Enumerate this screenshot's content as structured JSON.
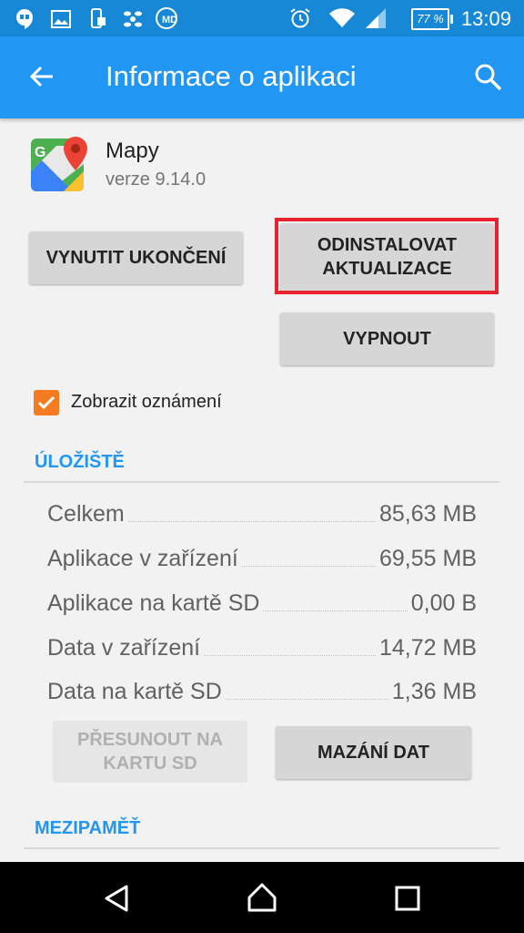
{
  "status_bar": {
    "battery": "77 %",
    "time": "13:09",
    "icons": [
      "hangouts-icon",
      "image-icon",
      "phone-sync-icon",
      "flower-icon",
      "md-app-icon",
      "alarm-icon",
      "wifi-icon",
      "signal-icon",
      "battery-icon"
    ]
  },
  "app_bar": {
    "title": "Informace o aplikaci",
    "color": "#2196f3"
  },
  "app": {
    "name": "Mapy",
    "version": "verze 9.14.0",
    "icon": "google-maps-icon"
  },
  "buttons": {
    "force_stop": "VYNUTIT UKONČENÍ",
    "uninstall_updates_line1": "ODINSTALOVAT",
    "uninstall_updates_line2": "AKTUALIZACE",
    "disable": "VYPNOUT"
  },
  "notifications": {
    "label": "Zobrazit oznámení",
    "checked": true
  },
  "storage": {
    "header": "ÚLOŽIŠTĚ",
    "rows": [
      {
        "label": "Celkem",
        "value": "85,63 MB"
      },
      {
        "label": "Aplikace v zařízení",
        "value": "69,55 MB"
      },
      {
        "label": "Aplikace na kartě SD",
        "value": "0,00 B"
      },
      {
        "label": "Data v zařízení",
        "value": "14,72 MB"
      },
      {
        "label": "Data na kartě SD",
        "value": "1,36 MB"
      }
    ],
    "move_line1": "PŘESUNOUT NA",
    "move_line2": "KARTU SD",
    "clear_data": "MAZÁNÍ DAT"
  },
  "cache": {
    "header": "MEZIPAMĚŤ"
  },
  "colors": {
    "accent": "#2196f3",
    "highlight": "#e8212e",
    "checkbox": "#f47b20"
  }
}
